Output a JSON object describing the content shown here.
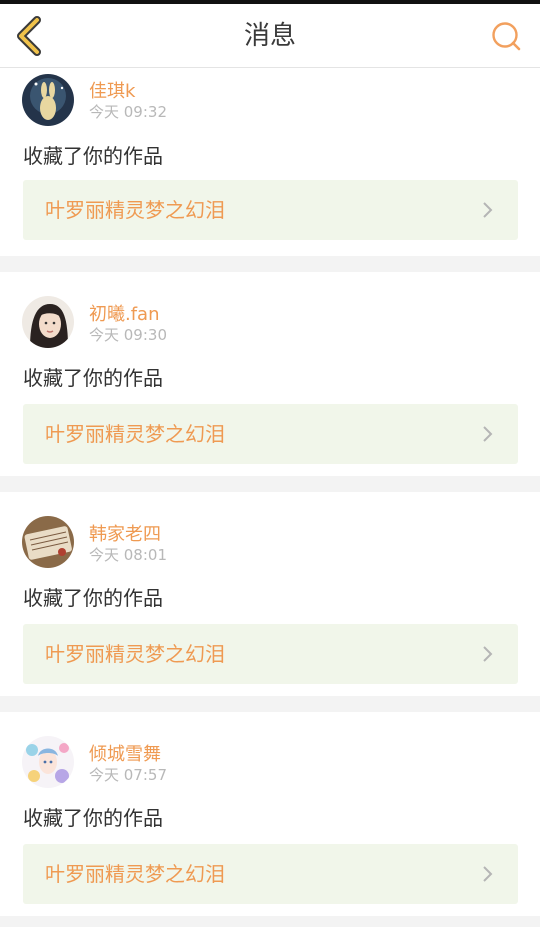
{
  "header": {
    "title": "消息",
    "back_icon": "back-chevron-icon",
    "search_icon": "search-icon",
    "accent_color": "#f0c24a",
    "search_color": "#f2a05e"
  },
  "messages": [
    {
      "name": "佳琪k",
      "time": "今天 09:32",
      "action": "收藏了你的作品",
      "work_title": "叶罗丽精灵梦之幻泪"
    },
    {
      "name": "初曦.fan",
      "time": "今天 09:30",
      "action": "收藏了你的作品",
      "work_title": "叶罗丽精灵梦之幻泪"
    },
    {
      "name": "韩家老四",
      "time": "今天 08:01",
      "action": "收藏了你的作品",
      "work_title": "叶罗丽精灵梦之幻泪"
    },
    {
      "name": "倾城雪舞",
      "time": "今天 07:57",
      "action": "收藏了你的作品",
      "work_title": "叶罗丽精灵梦之幻泪"
    }
  ],
  "colors": {
    "name": "#ef9a52",
    "time": "#b8b8b8",
    "link_bg": "#f1f6ea",
    "page_bg": "#f3f3f3"
  }
}
